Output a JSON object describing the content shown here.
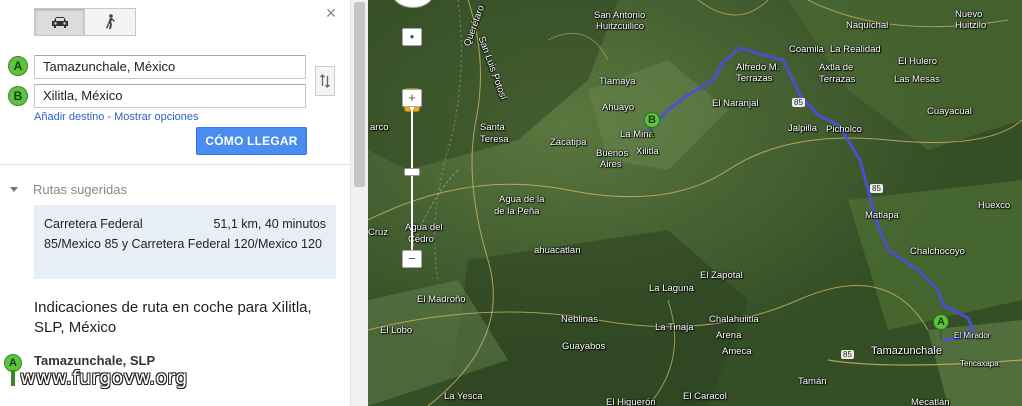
{
  "sidebar": {
    "modes": [
      {
        "name": "car-icon",
        "active": true
      },
      {
        "name": "walk-icon",
        "active": false
      }
    ],
    "close_icon": "close-icon",
    "origin": {
      "marker": "A",
      "value": "Tamazunchale, México"
    },
    "destination": {
      "marker": "B",
      "value": "Xilitla, México"
    },
    "swap_icon": "swap-icon",
    "add_destination": "Añadir destino",
    "separator": "-",
    "show_options": "Mostrar opciones",
    "go_button": "CÓMO LLEGAR",
    "routes_heading": "Rutas sugeridas",
    "route": {
      "name_line1": "Carretera Federal",
      "name_rest": "85/Mexico 85 y Carretera Federal 120/Mexico 120",
      "meta": "51,1 km, 40 minutos"
    },
    "directions_title": "Indicaciones de ruta en coche para Xilitla, SLP, México",
    "start_marker": "A",
    "start_label": "Tamazunchale, SLP",
    "watermark": "www.furgovw.org"
  },
  "map": {
    "zoom_in": "+",
    "zoom_out": "−",
    "markers": {
      "a": "A",
      "b": "B"
    },
    "route_color": "#4b4fd8",
    "labels": [
      {
        "id": "san-antonio",
        "text": "San Antonio"
      },
      {
        "id": "huitzcuilico",
        "text": "Huitzcuilico"
      },
      {
        "id": "san-luis-potosi",
        "text": "San Luis Potosí"
      },
      {
        "id": "queretaro",
        "text": "Querétaro"
      },
      {
        "id": "naquichal",
        "text": "Naquichal"
      },
      {
        "id": "nuevo",
        "text": "Nuevo"
      },
      {
        "id": "huitzilo",
        "text": "Huitzilo"
      },
      {
        "id": "coamila",
        "text": "Coamila"
      },
      {
        "id": "la-realidad",
        "text": "La Realidad"
      },
      {
        "id": "el-hulero",
        "text": "El Hulero"
      },
      {
        "id": "alfredo-m",
        "text": "Alfredo M."
      },
      {
        "id": "terrazas",
        "text": "Terrazas"
      },
      {
        "id": "axtla-de",
        "text": "Axtla de"
      },
      {
        "id": "terrazas2",
        "text": "Terrazas"
      },
      {
        "id": "las-mesas",
        "text": "Las Mesas"
      },
      {
        "id": "tlamaya",
        "text": "Tlamaya"
      },
      {
        "id": "ahuayo",
        "text": "Ahuayo"
      },
      {
        "id": "el-naranjal",
        "text": "El Naranjal"
      },
      {
        "id": "cuayacual",
        "text": "Cuayacual"
      },
      {
        "id": "arco",
        "text": "arco"
      },
      {
        "id": "santa",
        "text": "Santa"
      },
      {
        "id": "teresa",
        "text": "Teresa"
      },
      {
        "id": "zacatipa",
        "text": "Zacatipa"
      },
      {
        "id": "la-mina",
        "text": "La Mina"
      },
      {
        "id": "xilitla",
        "text": "Xilitla"
      },
      {
        "id": "jalpilla",
        "text": "Jalpilla"
      },
      {
        "id": "picholco",
        "text": "Picholco"
      },
      {
        "id": "buenos",
        "text": "Buenos"
      },
      {
        "id": "aires",
        "text": "Aires"
      },
      {
        "id": "huexco",
        "text": "Huexco"
      },
      {
        "id": "agua-de-la",
        "text": "Agua de la"
      },
      {
        "id": "pena",
        "text": "de la Peña"
      },
      {
        "id": "matlapa",
        "text": "Matlapa"
      },
      {
        "id": "cruz",
        "text": "Cruz"
      },
      {
        "id": "agua-del",
        "text": "Agua del"
      },
      {
        "id": "cedro",
        "text": "Cedro"
      },
      {
        "id": "ahuacatlan",
        "text": "ahuacatlan"
      },
      {
        "id": "chalchocoyo",
        "text": "Chalchocoyo"
      },
      {
        "id": "el-zapotal",
        "text": "El Zapotal"
      },
      {
        "id": "la-laguna",
        "text": "La Laguna"
      },
      {
        "id": "el-madrono",
        "text": "El Madroño"
      },
      {
        "id": "neblinas",
        "text": "Neblinas"
      },
      {
        "id": "chalahuiitla",
        "text": "Chalahuiitla"
      },
      {
        "id": "la-tinaja",
        "text": "La Tinaja"
      },
      {
        "id": "el-lobo",
        "text": "El Lobo"
      },
      {
        "id": "arena",
        "text": "Arena"
      },
      {
        "id": "guayabos",
        "text": "Guayabos"
      },
      {
        "id": "ameca",
        "text": "Ameca"
      },
      {
        "id": "tamazunchale",
        "text": "Tamazunchale"
      },
      {
        "id": "el-mirador",
        "text": "El Mirador"
      },
      {
        "id": "tencaxapa",
        "text": "Tencaxapa"
      },
      {
        "id": "taman",
        "text": "Tamán"
      },
      {
        "id": "la-yesca",
        "text": "La Yesca"
      },
      {
        "id": "el-higueron",
        "text": "El Higuerón"
      },
      {
        "id": "el-caracol",
        "text": "El Caracol"
      },
      {
        "id": "mecatlan",
        "text": "Mecatlán"
      },
      {
        "id": "hwy-85a",
        "text": "85"
      },
      {
        "id": "hwy-85b",
        "text": "85"
      },
      {
        "id": "hwy-85c",
        "text": "85"
      }
    ]
  }
}
